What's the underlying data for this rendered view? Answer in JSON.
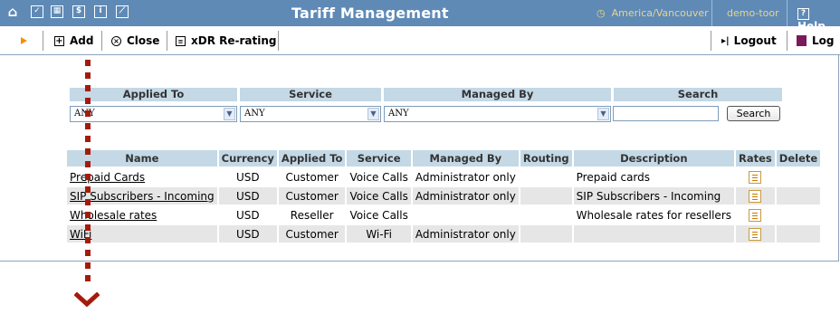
{
  "titlebar": {
    "title": "Tariff Management",
    "timezone": "America/Vancouver",
    "user": "demo-toor",
    "help": "Help",
    "icons": [
      "home-icon",
      "checkbox-icon",
      "calculator-icon",
      "dollar-icon",
      "info-icon",
      "chart-icon"
    ]
  },
  "toolbar": {
    "add": "Add",
    "close": "Close",
    "rerating": "xDR Re-rating",
    "logout": "Logout",
    "log": "Log"
  },
  "filter": {
    "headers": {
      "applied_to": "Applied To",
      "service": "Service",
      "managed_by": "Managed By",
      "search": "Search"
    },
    "applied_to_value": "ANY",
    "service_value": "ANY",
    "managed_by_value": "ANY",
    "search_value": "",
    "search_button": "Search"
  },
  "table": {
    "headers": {
      "name": "Name",
      "currency": "Currency",
      "applied_to": "Applied To",
      "service": "Service",
      "managed_by": "Managed By",
      "routing": "Routing",
      "description": "Description",
      "rates": "Rates",
      "delete": "Delete"
    },
    "rows": [
      {
        "name": "Prepaid Cards",
        "currency": "USD",
        "applied_to": "Customer",
        "service": "Voice Calls",
        "managed_by": "Administrator only",
        "routing": "",
        "description": "Prepaid cards"
      },
      {
        "name": "SIP Subscribers - Incoming",
        "currency": "USD",
        "applied_to": "Customer",
        "service": "Voice Calls",
        "managed_by": "Administrator only",
        "routing": "",
        "description": "SIP Subscribers - Incoming"
      },
      {
        "name": "Wholesale rates",
        "currency": "USD",
        "applied_to": "Reseller",
        "service": "Voice Calls",
        "managed_by": "",
        "routing": "",
        "description": "Wholesale rates for resellers"
      },
      {
        "name": "WiFi",
        "currency": "USD",
        "applied_to": "Customer",
        "service": "Wi-Fi",
        "managed_by": "Administrator only",
        "routing": "",
        "description": ""
      }
    ]
  },
  "colors": {
    "titlebar": "#5f8ab6",
    "header_cell": "#c4d8e6",
    "accent_arrow": "#a51b0b",
    "timezone_text": "#e6d590"
  }
}
